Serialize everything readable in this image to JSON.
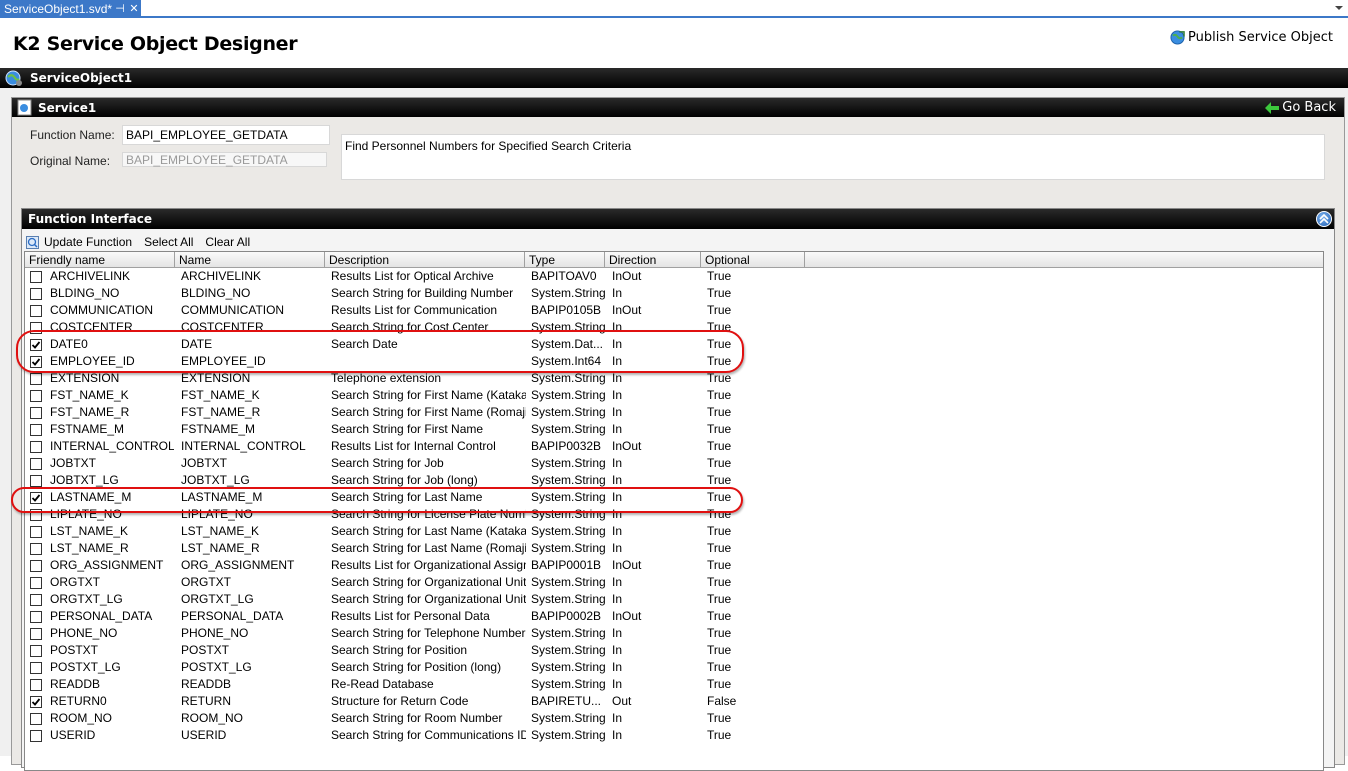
{
  "tab": {
    "label": "ServiceObject1.svd*",
    "pin": "⊣",
    "close": "✕"
  },
  "app": {
    "title": "K2 Service Object Designer",
    "publish_label": "Publish Service Object"
  },
  "service_object": {
    "name": "ServiceObject1"
  },
  "service": {
    "name": "Service1",
    "go_back_label": "Go Back",
    "function_name_label": "Function Name:",
    "function_name_value": "BAPI_EMPLOYEE_GETDATA",
    "original_name_label": "Original Name:",
    "original_name_value": "BAPI_EMPLOYEE_GETDATA",
    "description": "Find Personnel Numbers for Specified Search Criteria"
  },
  "function_interface": {
    "title": "Function Interface",
    "toolbar": {
      "update": "Update Function",
      "select_all": "Select All",
      "clear_all": "Clear All"
    },
    "columns": [
      "Friendly name",
      "Name",
      "Description",
      "Type",
      "Direction",
      "Optional"
    ],
    "rows": [
      {
        "checked": false,
        "friendly": "ARCHIVELINK",
        "name": "ARCHIVELINK",
        "desc": "Results List for Optical Archive",
        "type": "BAPITOAV0",
        "dir": "InOut",
        "opt": "True"
      },
      {
        "checked": false,
        "friendly": "BLDING_NO",
        "name": "BLDING_NO",
        "desc": "Search String for Building Number",
        "type": "System.String",
        "dir": "In",
        "opt": "True"
      },
      {
        "checked": false,
        "friendly": "COMMUNICATION",
        "name": "COMMUNICATION",
        "desc": "Results List for Communication",
        "type": "BAPIP0105B",
        "dir": "InOut",
        "opt": "True"
      },
      {
        "checked": false,
        "friendly": "COSTCENTER",
        "name": "COSTCENTER",
        "desc": "Search String for Cost Center",
        "type": "System.String",
        "dir": "In",
        "opt": "True"
      },
      {
        "checked": true,
        "friendly": "DATE0",
        "name": "DATE",
        "desc": "Search Date",
        "type": "System.Dat...",
        "dir": "In",
        "opt": "True"
      },
      {
        "checked": true,
        "friendly": "EMPLOYEE_ID",
        "name": "EMPLOYEE_ID",
        "desc": "",
        "type": "System.Int64",
        "dir": "In",
        "opt": "True"
      },
      {
        "checked": false,
        "friendly": "EXTENSION",
        "name": "EXTENSION",
        "desc": "Telephone extension",
        "type": "System.String",
        "dir": "In",
        "opt": "True"
      },
      {
        "checked": false,
        "friendly": "FST_NAME_K",
        "name": "FST_NAME_K",
        "desc": "Search String for First Name (Katakana)",
        "type": "System.String",
        "dir": "In",
        "opt": "True"
      },
      {
        "checked": false,
        "friendly": "FST_NAME_R",
        "name": "FST_NAME_R",
        "desc": "Search String for First Name (Romaji)",
        "type": "System.String",
        "dir": "In",
        "opt": "True"
      },
      {
        "checked": false,
        "friendly": "FSTNAME_M",
        "name": "FSTNAME_M",
        "desc": "Search String for First Name",
        "type": "System.String",
        "dir": "In",
        "opt": "True"
      },
      {
        "checked": false,
        "friendly": "INTERNAL_CONTROL",
        "name": "INTERNAL_CONTROL",
        "desc": "Results List for Internal Control",
        "type": "BAPIP0032B",
        "dir": "InOut",
        "opt": "True"
      },
      {
        "checked": false,
        "friendly": "JOBTXT",
        "name": "JOBTXT",
        "desc": "Search String for Job",
        "type": "System.String",
        "dir": "In",
        "opt": "True"
      },
      {
        "checked": false,
        "friendly": "JOBTXT_LG",
        "name": "JOBTXT_LG",
        "desc": "Search String for Job (long)",
        "type": "System.String",
        "dir": "In",
        "opt": "True"
      },
      {
        "checked": true,
        "friendly": "LASTNAME_M",
        "name": "LASTNAME_M",
        "desc": "Search String for Last Name",
        "type": "System.String",
        "dir": "In",
        "opt": "True"
      },
      {
        "checked": false,
        "friendly": "LIPLATE_NO",
        "name": "LIPLATE_NO",
        "desc": "Search String for License Plate Number",
        "type": "System.String",
        "dir": "In",
        "opt": "True"
      },
      {
        "checked": false,
        "friendly": "LST_NAME_K",
        "name": "LST_NAME_K",
        "desc": "Search String for Last Name (Katakana)",
        "type": "System.String",
        "dir": "In",
        "opt": "True"
      },
      {
        "checked": false,
        "friendly": "LST_NAME_R",
        "name": "LST_NAME_R",
        "desc": "Search String for Last Name (Romaji)",
        "type": "System.String",
        "dir": "In",
        "opt": "True"
      },
      {
        "checked": false,
        "friendly": "ORG_ASSIGNMENT",
        "name": "ORG_ASSIGNMENT",
        "desc": "Results List for Organizational Assign...",
        "type": "BAPIP0001B",
        "dir": "InOut",
        "opt": "True"
      },
      {
        "checked": false,
        "friendly": "ORGTXT",
        "name": "ORGTXT",
        "desc": "Search String for Organizational Unit",
        "type": "System.String",
        "dir": "In",
        "opt": "True"
      },
      {
        "checked": false,
        "friendly": "ORGTXT_LG",
        "name": "ORGTXT_LG",
        "desc": "Search String for Organizational Unit (l...",
        "type": "System.String",
        "dir": "In",
        "opt": "True"
      },
      {
        "checked": false,
        "friendly": "PERSONAL_DATA",
        "name": "PERSONAL_DATA",
        "desc": "Results List for Personal Data",
        "type": "BAPIP0002B",
        "dir": "InOut",
        "opt": "True"
      },
      {
        "checked": false,
        "friendly": "PHONE_NO",
        "name": "PHONE_NO",
        "desc": "Search String for Telephone Number",
        "type": "System.String",
        "dir": "In",
        "opt": "True"
      },
      {
        "checked": false,
        "friendly": "POSTXT",
        "name": "POSTXT",
        "desc": "Search String for Position",
        "type": "System.String",
        "dir": "In",
        "opt": "True"
      },
      {
        "checked": false,
        "friendly": "POSTXT_LG",
        "name": "POSTXT_LG",
        "desc": "Search String for Position (long)",
        "type": "System.String",
        "dir": "In",
        "opt": "True"
      },
      {
        "checked": false,
        "friendly": "READDB",
        "name": "READDB",
        "desc": "Re-Read Database",
        "type": "System.String",
        "dir": "In",
        "opt": "True"
      },
      {
        "checked": true,
        "friendly": "RETURN0",
        "name": "RETURN",
        "desc": "Structure for Return Code",
        "type": "BAPIRETU...",
        "dir": "Out",
        "opt": "False"
      },
      {
        "checked": false,
        "friendly": "ROOM_NO",
        "name": "ROOM_NO",
        "desc": "Search String for Room Number",
        "type": "System.String",
        "dir": "In",
        "opt": "True"
      },
      {
        "checked": false,
        "friendly": "USERID",
        "name": "USERID",
        "desc": "Search String for Communications ID",
        "type": "System.String",
        "dir": "In",
        "opt": "True"
      }
    ]
  },
  "colors": {
    "tab_blue": "#3c78c8",
    "highlight_red": "#e01010",
    "header_black": "#000000"
  }
}
